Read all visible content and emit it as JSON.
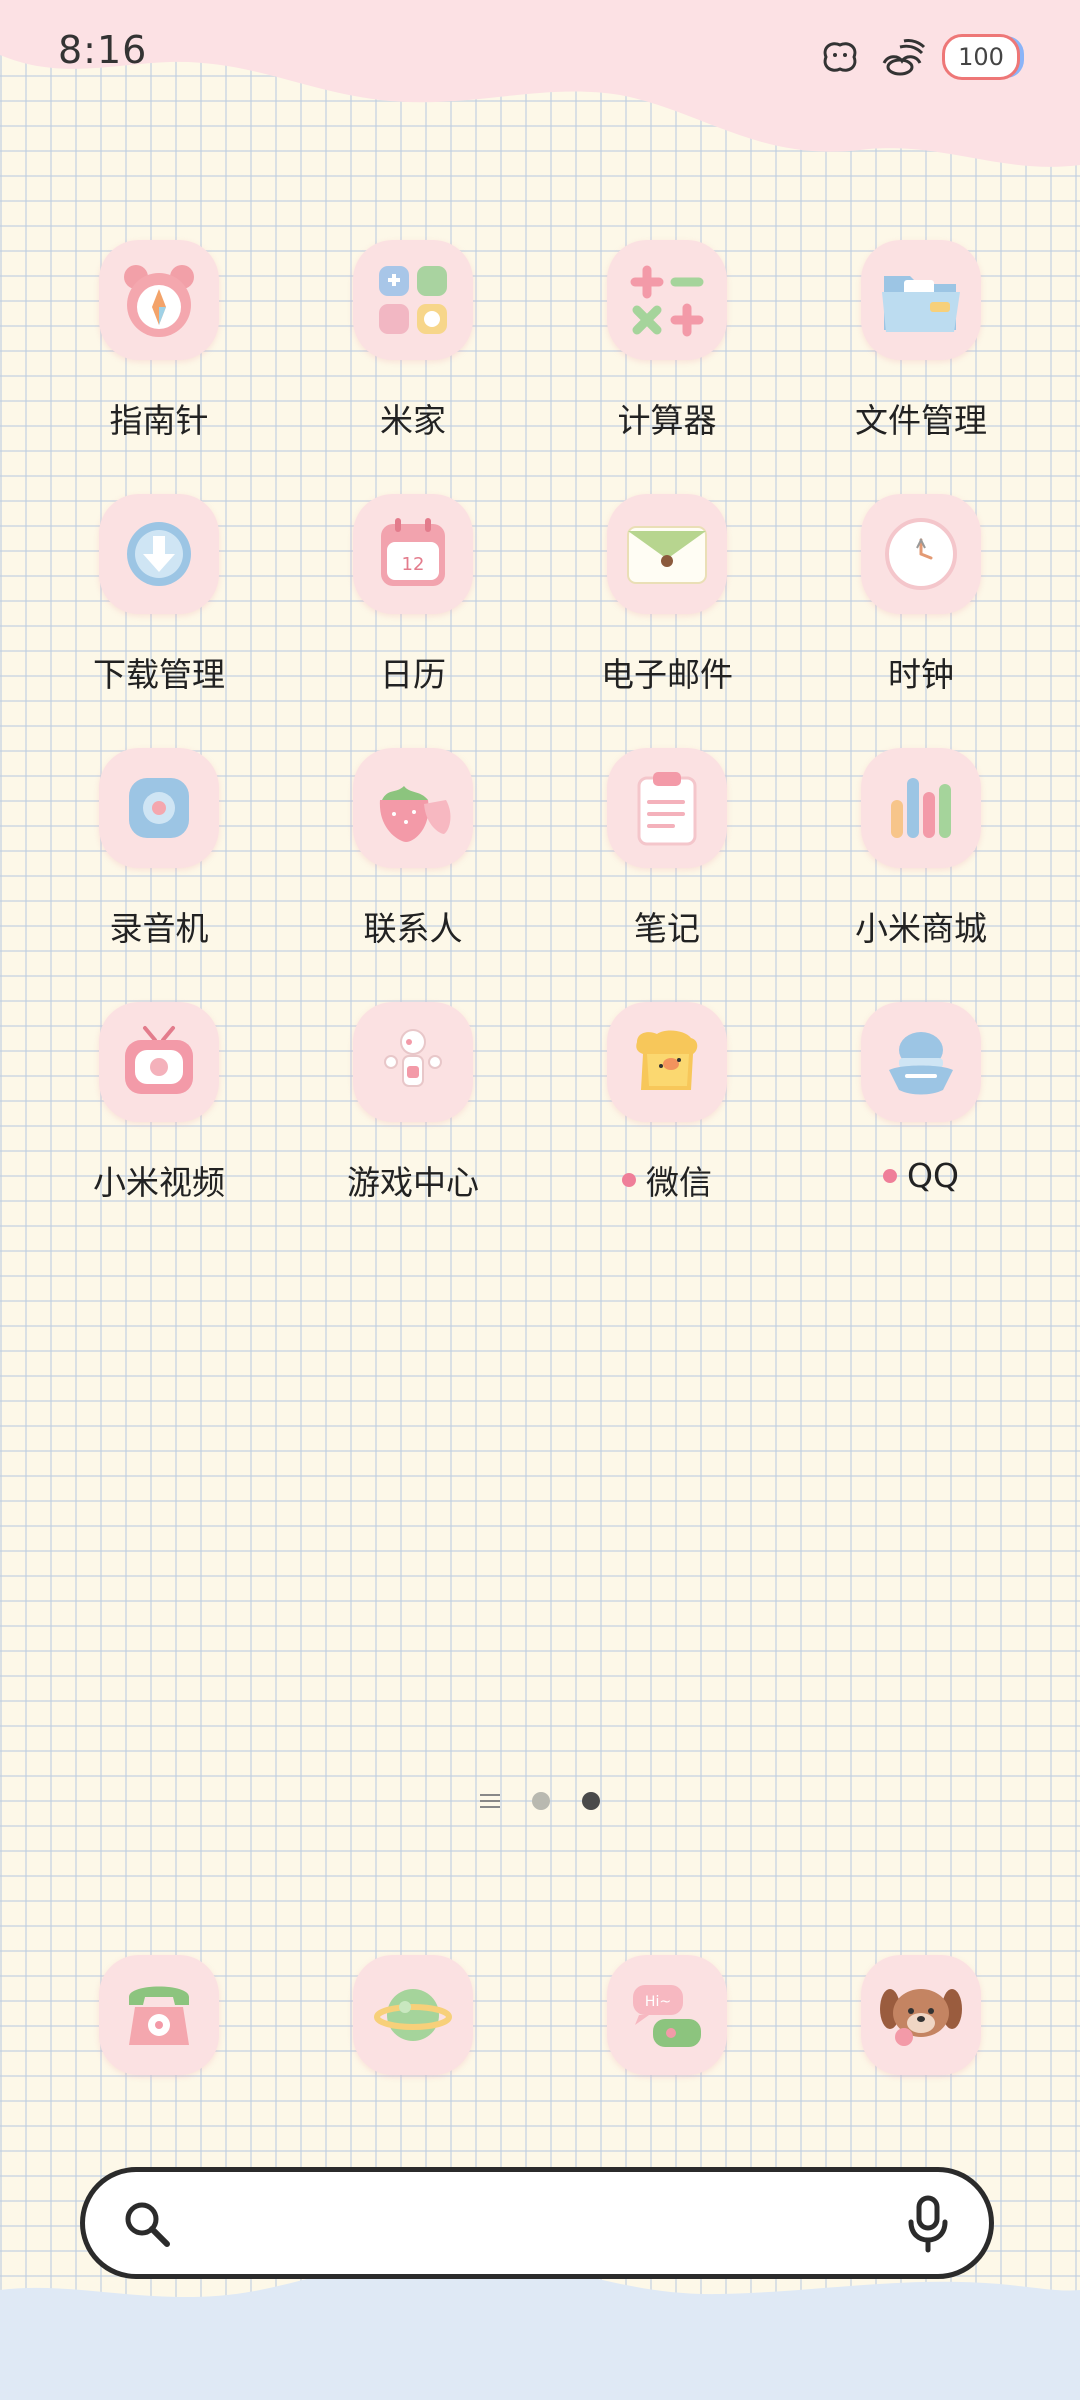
{
  "status_bar": {
    "time": "8:16",
    "battery": "100"
  },
  "apps": [
    {
      "label": "指南针",
      "icon": "compass-bear-icon"
    },
    {
      "label": "米家",
      "icon": "mijia-grid-icon"
    },
    {
      "label": "计算器",
      "icon": "calculator-icon"
    },
    {
      "label": "文件管理",
      "icon": "folder-icon"
    },
    {
      "label": "下载管理",
      "icon": "download-icon"
    },
    {
      "label": "日历",
      "icon": "calendar-icon"
    },
    {
      "label": "电子邮件",
      "icon": "envelope-icon"
    },
    {
      "label": "时钟",
      "icon": "clock-icon"
    },
    {
      "label": "录音机",
      "icon": "recorder-icon"
    },
    {
      "label": "联系人",
      "icon": "strawberry-icon"
    },
    {
      "label": "笔记",
      "icon": "notes-clipboard-icon"
    },
    {
      "label": "小米商城",
      "icon": "mall-bars-icon"
    },
    {
      "label": "小米视频",
      "icon": "tv-icon"
    },
    {
      "label": "游戏中心",
      "icon": "game-figure-icon"
    },
    {
      "label": "微信",
      "icon": "wechat-toast-icon",
      "new_dot": true
    },
    {
      "label": "QQ",
      "icon": "qq-hat-icon",
      "new_dot": true
    }
  ],
  "dock": [
    {
      "icon": "phone-icon"
    },
    {
      "icon": "browser-planet-icon"
    },
    {
      "icon": "messages-icon"
    },
    {
      "icon": "puppy-icon"
    }
  ],
  "pager": {
    "pages": 2,
    "current": 2
  },
  "colors": {
    "tile": "#fbe1e2",
    "dot": "#ef7f99",
    "wave_top": "#fce1e4",
    "wave_bottom": "#dfe9f5"
  }
}
